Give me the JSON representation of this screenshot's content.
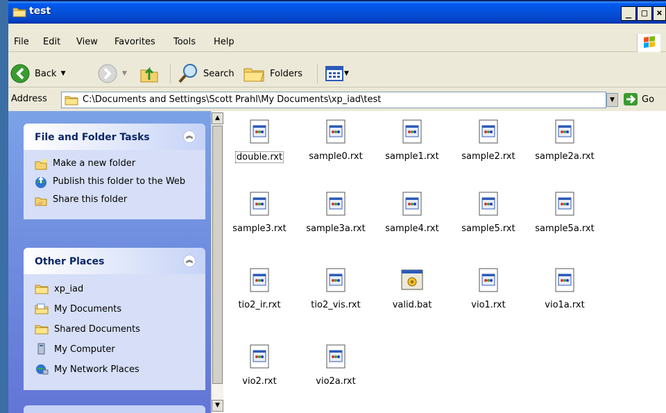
{
  "window": {
    "title": "test"
  },
  "menu": [
    "File",
    "Edit",
    "View",
    "Favorites",
    "Tools",
    "Help"
  ],
  "toolbar": {
    "back": "Back",
    "search": "Search",
    "folders": "Folders"
  },
  "address": {
    "label": "Address",
    "path": "C:\\Documents and Settings\\Scott Prahl\\My Documents\\xp_iad\\test",
    "go": "Go"
  },
  "tasks_panel": {
    "title": "File and Folder Tasks",
    "items": [
      "Make a new folder",
      "Publish this folder to the Web",
      "Share this folder"
    ]
  },
  "places_panel": {
    "title": "Other Places",
    "items": [
      "xp_iad",
      "My Documents",
      "Shared Documents",
      "My Computer",
      "My Network Places"
    ]
  },
  "files": [
    "double.rxt",
    "sample0.rxt",
    "sample1.rxt",
    "sample2.rxt",
    "sample2a.rxt",
    "sample3.rxt",
    "sample3a.rxt",
    "sample4.rxt",
    "sample5.rxt",
    "sample5a.rxt",
    "tio2_ir.rxt",
    "tio2_vis.rxt",
    "valid.bat",
    "vio1.rxt",
    "vio1a.rxt",
    "vio2.rxt",
    "vio2a.rxt"
  ],
  "icons": {
    "title": "folder-icon",
    "rxt": "document-icon",
    "bat": "batch-file-icon"
  }
}
